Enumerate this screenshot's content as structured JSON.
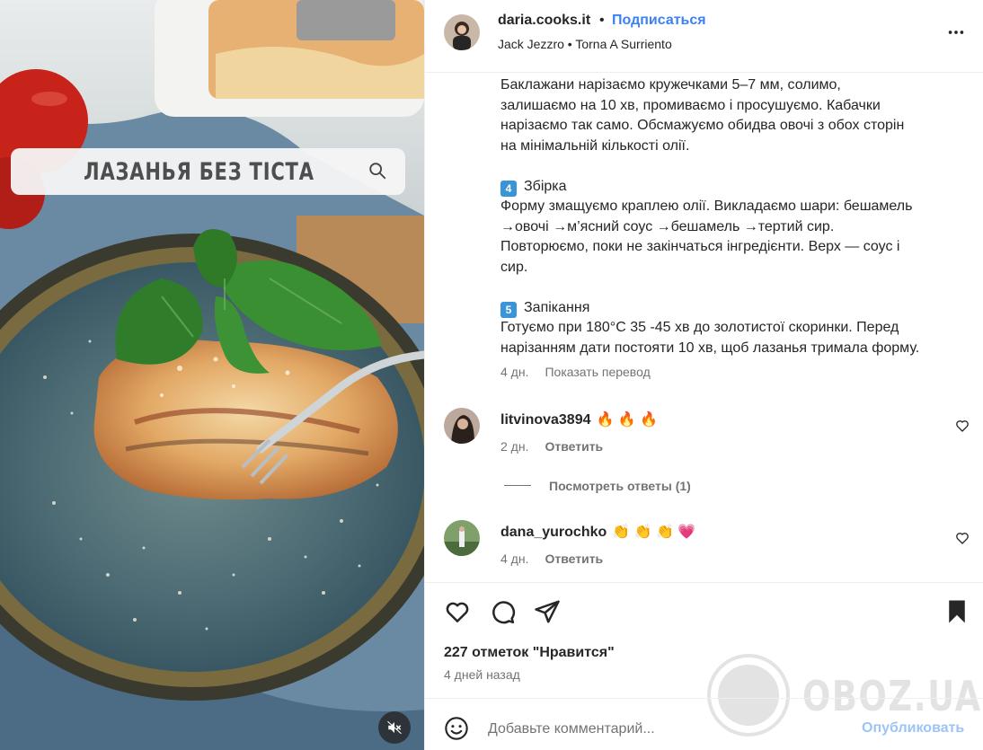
{
  "media": {
    "overlay_title": "ЛАЗАНЬЯ БЕЗ ТІСТА",
    "search_icon": "search-icon",
    "mute_icon": "speaker-muted-icon"
  },
  "header": {
    "username": "daria.cooks.it",
    "separator": "•",
    "follow_label": "Подписаться",
    "audio": "Jack Jezzro • Torna A Surriento",
    "more_icon": "more-horizontal-icon"
  },
  "caption": {
    "para1": [
      "Баклажани нарізаємо кружечками 5–7 мм, солимо,",
      "залишаємо на 10 хв, промиваємо і просушуємо. Кабачки",
      "нарізаємо так само. Обсмажуємо обидва овочі з обох сторін",
      "на мінімальній кількості олії."
    ],
    "step4_number": "4",
    "step4_title": "Збірка",
    "para2": [
      "Форму змащуємо краплею олії. Викладаємо шари: бешамель",
      "→овочі →м’ясний соус →бешамель →тертий сир.",
      "Повторюємо, поки не закінчаться інгредієнти. Верх — соус і",
      "сир."
    ],
    "step5_number": "5",
    "step5_title": "Запікання",
    "para3": [
      "Готуємо при 180°C 35 -45 хв до золотистої скоринки. Перед",
      "нарізанням дати постояти 10 хв, щоб лазанья тримала форму."
    ],
    "age": "4 дн.",
    "translate_label": "Показать перевод"
  },
  "comments": [
    {
      "user": "litvinova3894",
      "text": "🔥 🔥 🔥",
      "age": "2 дн.",
      "reply_label": "Ответить"
    },
    {
      "user": "dana_yurochko",
      "text": "👏 👏 👏 💗",
      "age": "4 дн.",
      "reply_label": "Ответить"
    }
  ],
  "view_replies": "Посмотреть ответы (1)",
  "actions": {
    "like_icon": "heart-icon",
    "comment_icon": "comment-icon",
    "share_icon": "send-icon",
    "save_icon": "bookmark-icon"
  },
  "likes": "227 отметок \"Нравится\"",
  "date": "4 дней назад",
  "composer": {
    "placeholder": "Добавьте комментарий...",
    "post_label": "Опубликовать",
    "emoji_icon": "smiley-icon"
  },
  "watermark": "OBOZ.UA",
  "colors": {
    "link_blue": "#3b82f6",
    "post_disabled": "#9cc4f6",
    "keycap_blue": "#3a94d8",
    "muted_text": "#737373"
  }
}
